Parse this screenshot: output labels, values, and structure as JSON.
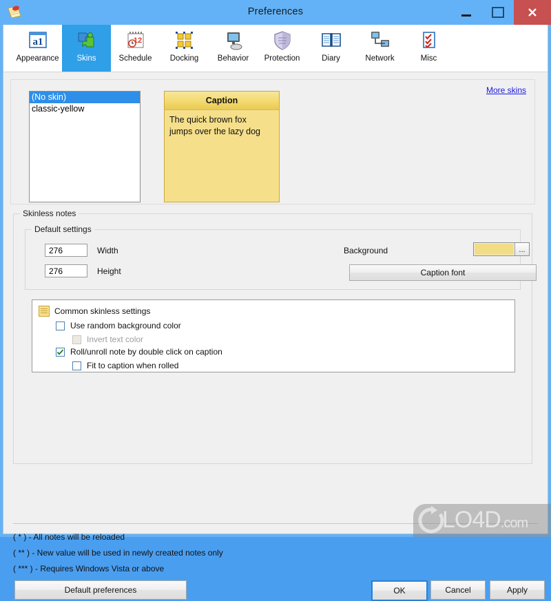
{
  "window": {
    "title": "Preferences",
    "app_icon": "sticky-note-icon",
    "controls": {
      "minimize": "minimize-icon",
      "maximize": "maximize-icon",
      "close": "close-icon"
    },
    "colors": {
      "titlebar": "#63b2f7",
      "close_button": "#c75050",
      "selected_tab": "#2f9fe8",
      "client": "#f0f0f0"
    }
  },
  "toolbar": {
    "tabs": [
      {
        "label": "Appearance",
        "icon": "appearance-icon",
        "selected": false
      },
      {
        "label": "Skins",
        "icon": "skins-puzzle-icon",
        "selected": true
      },
      {
        "label": "Schedule",
        "icon": "schedule-calendar-icon",
        "selected": false
      },
      {
        "label": "Docking",
        "icon": "docking-grid-icon",
        "selected": false
      },
      {
        "label": "Behavior",
        "icon": "behavior-monitor-icon",
        "selected": false
      },
      {
        "label": "Protection",
        "icon": "protection-shield-icon",
        "selected": false
      },
      {
        "label": "Diary",
        "icon": "diary-book-icon",
        "selected": false
      },
      {
        "label": "Network",
        "icon": "network-computers-icon",
        "selected": false
      },
      {
        "label": "Misc",
        "icon": "misc-checklist-icon",
        "selected": false
      }
    ]
  },
  "skins_panel": {
    "list": [
      {
        "label": "(No skin)",
        "selected": true
      },
      {
        "label": "classic-yellow",
        "selected": false
      }
    ],
    "more_skins_link": "More skins",
    "preview": {
      "caption": "Caption",
      "body_line1": "The quick brown fox",
      "body_line2": "jumps over the lazy dog",
      "caption_color_top": "#f7e79a",
      "caption_color_bottom": "#e8c955",
      "body_color": "#f5df8a"
    }
  },
  "skinless_notes": {
    "legend": "Skinless notes",
    "default_settings": {
      "legend": "Default settings",
      "width_value": "276",
      "width_label": "Width",
      "height_value": "276",
      "height_label": "Height",
      "background_label": "Background",
      "background_color": "#f2dd86",
      "background_browse": "...",
      "caption_font_button": "Caption font"
    },
    "common": {
      "title": "Common skinless settings",
      "icon": "note-lines-icon",
      "items": [
        {
          "label": "Use random background color",
          "checked": false,
          "disabled": false,
          "indent": 0
        },
        {
          "label": "Invert text color",
          "checked": false,
          "disabled": true,
          "indent": 1
        },
        {
          "label": "Roll/unroll note by double click on caption",
          "checked": true,
          "disabled": false,
          "indent": 0
        },
        {
          "label": "Fit to caption when rolled",
          "checked": false,
          "disabled": false,
          "indent": 1
        }
      ]
    }
  },
  "footer": {
    "legend_lines": [
      "( * ) - All notes will be reloaded",
      "( ** ) - New value will be used in newly created notes only",
      "( *** ) - Requires Windows Vista or above"
    ],
    "buttons": {
      "default_preferences": "Default preferences",
      "ok": "OK",
      "cancel": "Cancel",
      "apply": "Apply"
    }
  },
  "watermark": {
    "text": "LO4D",
    "domain": ".com",
    "logo": "circular-arrow-logo"
  }
}
